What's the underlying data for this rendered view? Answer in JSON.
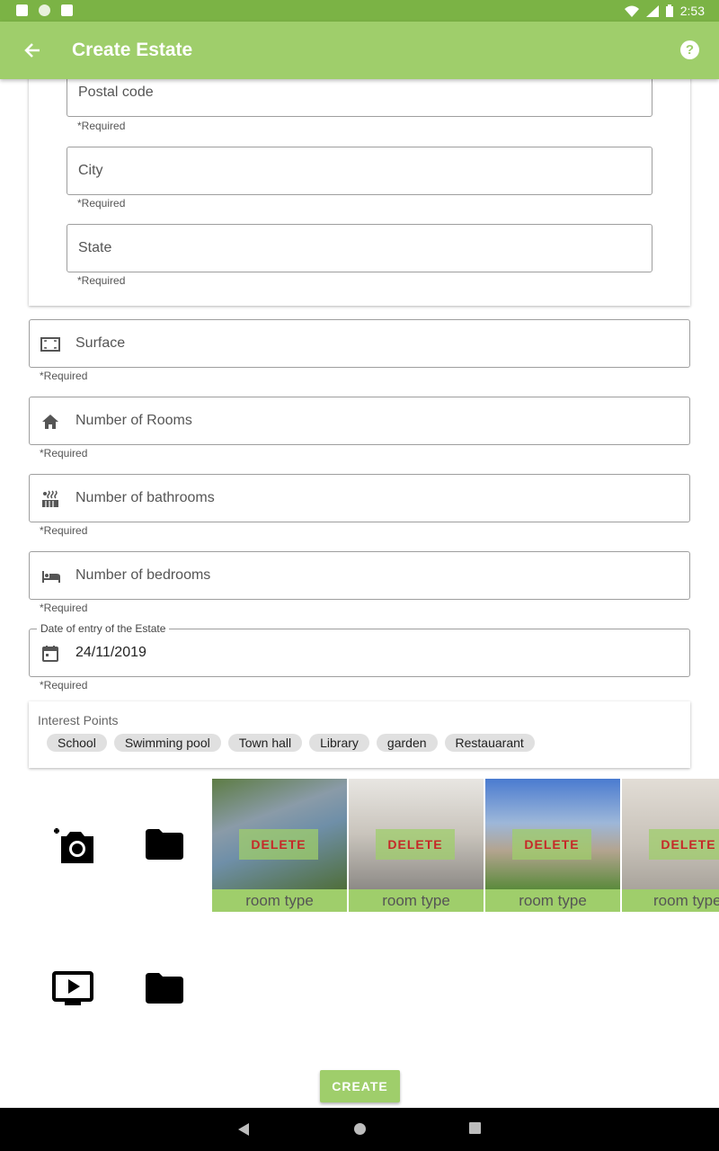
{
  "status": {
    "time": "2:53"
  },
  "appbar": {
    "title": "Create Estate",
    "back_icon": "arrow-back-icon",
    "help_icon": "help-icon"
  },
  "address": {
    "postal_code": "Postal code",
    "city": "City",
    "state": "State",
    "required": "*Required"
  },
  "fields": {
    "surface": "Surface",
    "rooms": "Number of Rooms",
    "bathrooms": "Number of bathrooms",
    "bedrooms": "Number of bedrooms",
    "date_label": "Date of entry of the Estate",
    "date_value": "24/11/2019",
    "required": "*Required"
  },
  "interest": {
    "title": "Interest Points",
    "chips": [
      "School",
      "Swimming pool",
      "Town hall",
      "Library",
      "garden",
      "Restauarant"
    ]
  },
  "photos": [
    {
      "delete": "DELETE",
      "room": "room type",
      "color": "#6e8a5a"
    },
    {
      "delete": "DELETE",
      "room": "room type",
      "color": "#bfb8ae"
    },
    {
      "delete": "DELETE",
      "room": "room type",
      "color": "#8fa7c4"
    },
    {
      "delete": "DELETE",
      "room": "room type",
      "color": "#c9c3b8"
    }
  ],
  "create_label": "CREATE",
  "colors": {
    "accent": "#9fce6b",
    "statusbar": "#7bb345",
    "delete": "#c62828"
  }
}
